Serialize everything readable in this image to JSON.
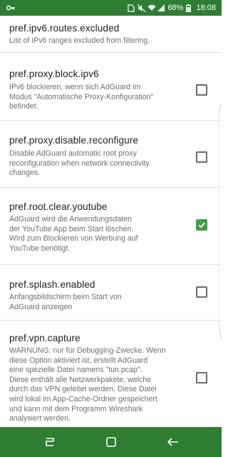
{
  "statusbar": {
    "battery_percent": "68%",
    "time": "18:08",
    "left_icon": "key-icon",
    "right_icons": [
      "sim-icon",
      "mute-icon",
      "wifi-icon",
      "signal-icon",
      "battery-icon"
    ]
  },
  "prefs": [
    {
      "title": "pref.ipv6.routes.excluded",
      "summary": [
        "List of IPv6 ranges excluded from filtering."
      ],
      "has_checkbox": false
    },
    {
      "title": "pref.proxy.block.ipv6",
      "summary": [
        "IPv6 blockieren, wenn sich AdGuard im",
        "Modus \"Automatische Proxy-Konfiguration\"",
        "befindet."
      ],
      "has_checkbox": true,
      "checked": false
    },
    {
      "title": "pref.proxy.disable.reconfigure",
      "summary": [
        "Disable AdGuard automatic root proxy",
        "reconfiguration when network connectivity",
        "changes."
      ],
      "has_checkbox": true,
      "checked": false
    },
    {
      "title": "pref.root.clear.youtube",
      "summary": [
        "AdGuard wird die Anwendungsdaten",
        "der YouTube App beim Start löschen.",
        "Wird zum Blockieren von Werbung auf",
        "YouTube benötigt."
      ],
      "has_checkbox": true,
      "checked": true
    },
    {
      "title": "pref.splash.enabled",
      "summary": [
        "Anfangsbildschirm beim Start von",
        "AdGuard anzeigen"
      ],
      "has_checkbox": true,
      "checked": false
    },
    {
      "title": "pref.vpn.capture",
      "summary": [
        "WARNUNG: nur für Debugging-Zwecke. Wenn",
        "diese Option aktiviert ist, erstellt AdGuard",
        "eine spezielle Datei namens \"tun.pcap\".",
        "Diese enthält alle Netzwerkpakete, welche",
        "durch das VPN geleitet werden. Diese Datei",
        "wird lokal im App-Cache-Ordner gespeichert",
        "und kann mit dem Programm Wireshark",
        "analysiert werden."
      ],
      "has_checkbox": true,
      "checked": false
    }
  ],
  "navbar": {
    "buttons": [
      "recent-apps-icon",
      "home-icon",
      "back-icon"
    ]
  },
  "colors": {
    "bars": "#2e7d32",
    "accent": "#43a047"
  }
}
